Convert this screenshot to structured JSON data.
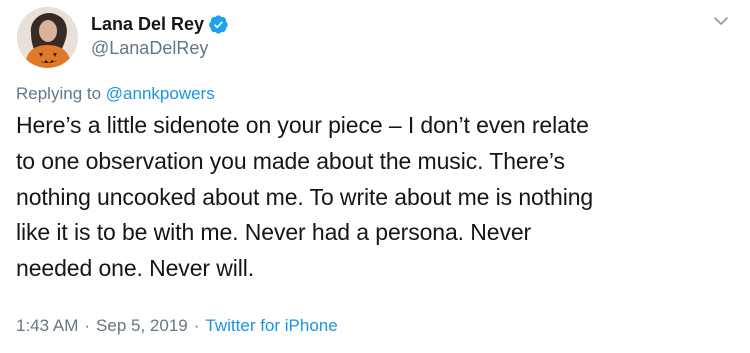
{
  "author": {
    "display_name": "Lana Del Rey",
    "handle": "@LanaDelRey",
    "verified": true
  },
  "reply": {
    "prefix": "Replying to",
    "mention": "@annkpowers"
  },
  "tweet": {
    "text_lines": [
      "Here’s a little sidenote on your piece – I don’t even relate",
      "to one observation you made about the music. There’s",
      "nothing uncooked about me. To write about me is nothing",
      "like it is to be with me. Never had a persona. Never",
      "needed one. Never will."
    ]
  },
  "meta": {
    "time": "1:43 AM",
    "separator": "·",
    "date": "Sep 5, 2019",
    "source": "Twitter for iPhone"
  },
  "icons": {
    "verified": "verified-badge-icon",
    "menu": "chevron-down-icon"
  },
  "colors": {
    "text": "#14171a",
    "secondary": "#657786",
    "link": "#1b95e0",
    "verified": "#1da1f2"
  }
}
